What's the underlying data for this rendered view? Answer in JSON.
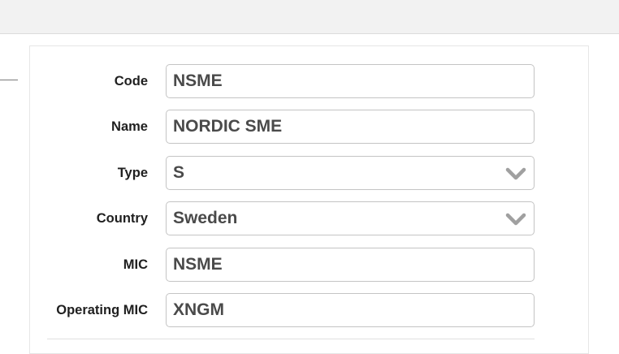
{
  "form": {
    "fields": [
      {
        "label": "Code",
        "value": "NSME",
        "kind": "text"
      },
      {
        "label": "Name",
        "value": "NORDIC SME",
        "kind": "text"
      },
      {
        "label": "Type",
        "value": "S",
        "kind": "select",
        "icon": "chevron-down-icon"
      },
      {
        "label": "Country",
        "value": "Sweden",
        "kind": "select",
        "icon": "chevron-down-icon"
      },
      {
        "label": "MIC",
        "value": "NSME",
        "kind": "text"
      },
      {
        "label": "Operating MIC",
        "value": "XNGM",
        "kind": "text"
      }
    ]
  },
  "colors": {
    "topbar_bg": "#f2f2f2",
    "field_border": "#c4c4c4",
    "field_text": "#4a4a4a",
    "label_text": "#1f1f1f",
    "chevron": "#a0a0a0"
  }
}
